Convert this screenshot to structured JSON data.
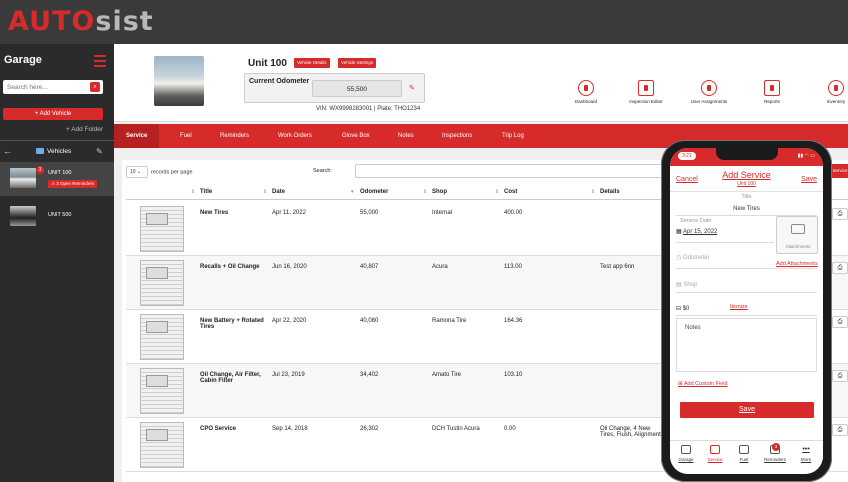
{
  "logo": {
    "part1": "AUTO",
    "part2": "sist"
  },
  "sidebar": {
    "title": "Garage",
    "search_placeholder": "Search here...",
    "add_vehicle": "+ Add Vehicle",
    "add_folder": "+ Add Folder",
    "folder": "Vehicles",
    "vehicles": [
      {
        "name": "UNIT 100",
        "badge": "3",
        "reminder": "3 Open Reminders",
        "selected": true
      },
      {
        "name": "UNIT 500",
        "selected": false
      }
    ]
  },
  "header": {
    "unit_name": "Unit 100",
    "vehicle_details": "Vehicle Details",
    "vehicle_settings": "Vehicle Settings",
    "odometer_label": "Current Odometer",
    "odometer_value": "55,500",
    "vin_plate": "VIN: WX9998283001 | Plate: THO1234",
    "tools": [
      {
        "name": "dashboard",
        "label": "Dashboard",
        "icon": "dashboard-icon"
      },
      {
        "name": "inspection-editor",
        "label": "Inspection Editor",
        "icon": "inspection-icon"
      },
      {
        "name": "user-assignments",
        "label": "User Assignments",
        "icon": "users-icon"
      },
      {
        "name": "reports",
        "label": "Reports",
        "icon": "reports-icon"
      },
      {
        "name": "inventory",
        "label": "Inventory",
        "icon": "inventory-icon"
      }
    ]
  },
  "tabs": [
    "Service",
    "Fuel",
    "Reminders",
    "Work Orders",
    "Glove Box",
    "Notes",
    "Inspections",
    "Trip Log"
  ],
  "table": {
    "records_per_page_value": "10",
    "records_per_page_label": "records per page",
    "search_label": "Search:",
    "columns": [
      "Title",
      "Date",
      "Odometer",
      "Shop",
      "Cost",
      "Details"
    ],
    "rows": [
      {
        "title": "New Tires",
        "date": "Apr 11, 2022",
        "odometer": "55,000",
        "shop": "Internal",
        "cost": "400.00",
        "details": ""
      },
      {
        "title": "Recalls + Oil Change",
        "date": "Jun 16, 2020",
        "odometer": "40,807",
        "shop": "Acura",
        "cost": "113.00",
        "details": "Test app 6nn"
      },
      {
        "title": "New Battery + Rotated Tires",
        "date": "Apr 22, 2020",
        "odometer": "40,080",
        "shop": "Ramona Tire",
        "cost": "164.36",
        "details": ""
      },
      {
        "title": "Oil Change, Air Filter, Cabin Filter",
        "date": "Jul 23, 2019",
        "odometer": "34,402",
        "shop": "Amato Tire",
        "cost": "103.10",
        "details": ""
      },
      {
        "title": "CPO Service",
        "date": "Sep 14, 2018",
        "odometer": "26,302",
        "shop": "DCH Tustin Acura",
        "cost": "0.00",
        "details": "Oil Change, 4 New Tires, Flush, Alignment"
      }
    ],
    "side_label": "Service"
  },
  "phone": {
    "time": "3:21",
    "cancel": "Cancel",
    "save": "Save",
    "title": "Add Service",
    "subtitle": "Unit 100",
    "field_title_label": "Title",
    "field_title_value": "New Tires",
    "service_date_label": "Service Date",
    "service_date_value": "Apr 15, 2022",
    "attachments_label": "Attachments",
    "add_attachments": "Add Attachments",
    "odometer_placeholder": "Odometer",
    "shop_placeholder": "Shop",
    "cost_value": "$0",
    "itemize": "Itemize",
    "notes_label": "Notes",
    "add_custom_field": "Add Custom Field",
    "save_button": "Save",
    "nav": [
      {
        "label": "Garage",
        "active": false
      },
      {
        "label": "Service",
        "active": true
      },
      {
        "label": "Fuel",
        "active": false
      },
      {
        "label": "Reminders",
        "active": false
      },
      {
        "label": "More",
        "active": false
      }
    ],
    "reminders_badge": "3"
  }
}
